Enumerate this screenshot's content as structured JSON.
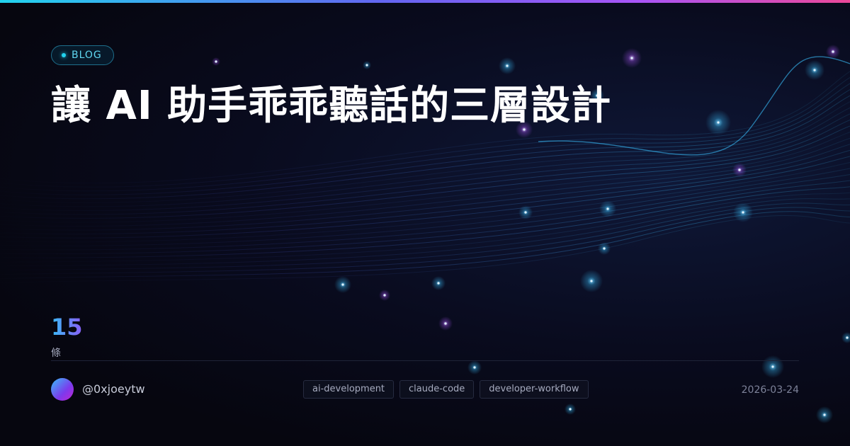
{
  "badge": {
    "label": "BLOG"
  },
  "post": {
    "title": "讓 AI 助手乖乖聽話的三層設計",
    "stat_value": "15",
    "stat_unit": "條",
    "author": "@0xjoeytw",
    "date": "2026-03-24",
    "tags": [
      "ai-development",
      "claude-code",
      "developer-workflow"
    ]
  },
  "colors": {
    "accent_cyan": "#22d3ee",
    "accent_purple": "#8b5cf6",
    "accent_pink": "#ec4899",
    "background": "#06060f"
  },
  "icons": {
    "badge_dot": "dot-icon",
    "avatar": "gradient-avatar"
  }
}
